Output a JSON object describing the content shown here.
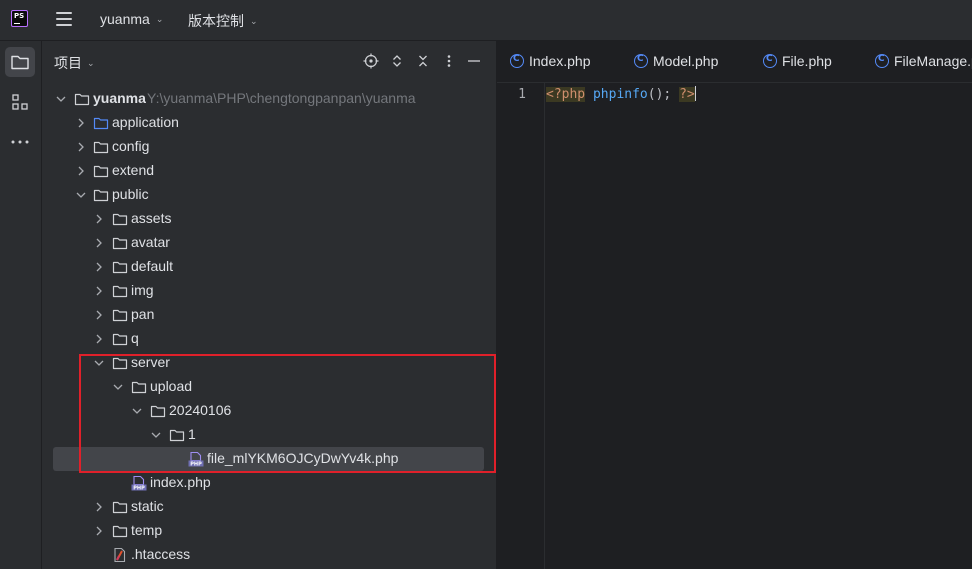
{
  "topbar": {
    "logo_text": "PS",
    "project_menu": "yuanma",
    "vcs_menu": "版本控制"
  },
  "panel": {
    "title": "项目"
  },
  "tree": {
    "root": {
      "label": "yuanma",
      "path": "Y:\\yuanma\\PHP\\chengtongpanpan\\yuanma"
    },
    "application": "application",
    "config": "config",
    "extend": "extend",
    "public": "public",
    "assets": "assets",
    "avatar": "avatar",
    "default": "default",
    "img": "img",
    "pan": "pan",
    "q": "q",
    "server": "server",
    "upload": "upload",
    "date_folder": "20240106",
    "one_folder": "1",
    "uploaded_file": "file_mlYKM6OJCyDwYv4k.php",
    "index_php": "index.php",
    "static": "static",
    "temp": "temp",
    "htaccess": ".htaccess"
  },
  "tabs": [
    {
      "label": "Index.php"
    },
    {
      "label": "Model.php"
    },
    {
      "label": "File.php"
    },
    {
      "label": "FileManage.php"
    }
  ],
  "editor": {
    "line_number": "1",
    "code_open": "<?php",
    "code_fn": "phpinfo",
    "code_punct": "();",
    "code_close": "?>"
  },
  "colors": {
    "selection_highlight": "#e0202a",
    "accent_blue": "#548af7"
  }
}
